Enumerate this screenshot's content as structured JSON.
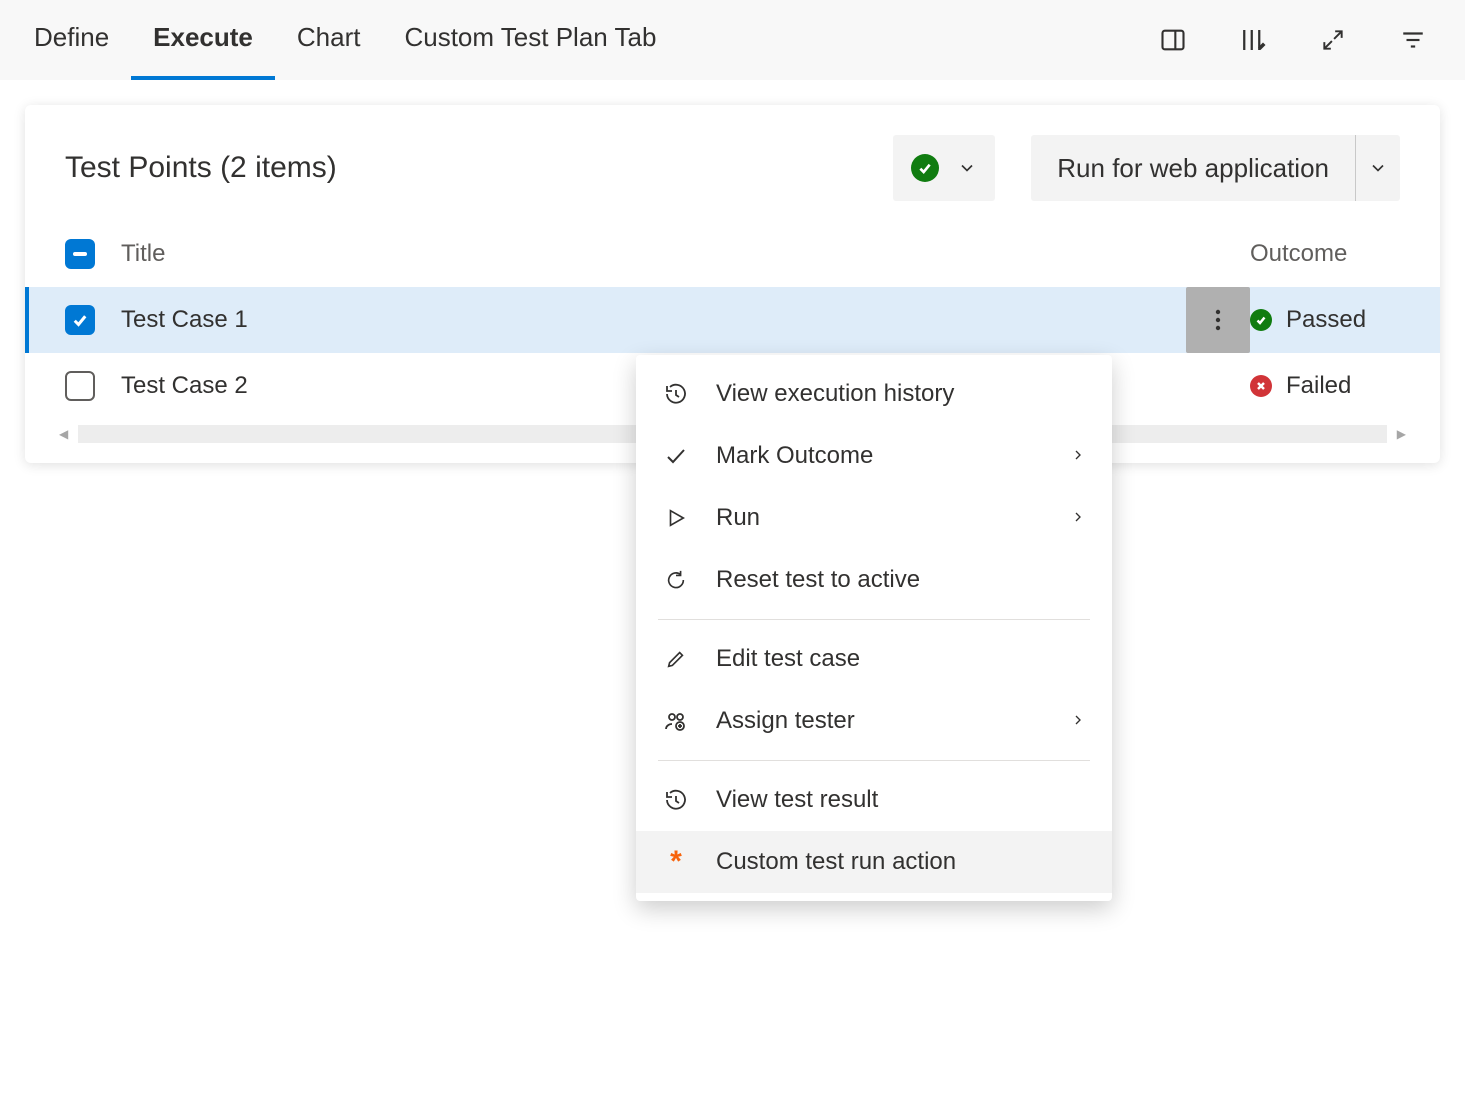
{
  "tabs": {
    "items": [
      {
        "label": "Define",
        "active": false
      },
      {
        "label": "Execute",
        "active": true
      },
      {
        "label": "Chart",
        "active": false
      },
      {
        "label": "Custom Test Plan Tab",
        "active": false
      }
    ]
  },
  "panel": {
    "title": "Test Points (2 items)",
    "runLabel": "Run for web application"
  },
  "columns": {
    "title": "Title",
    "outcome": "Outcome"
  },
  "rows": [
    {
      "title": "Test Case 1",
      "outcome": "Passed",
      "outcomeType": "pass",
      "checked": true,
      "selected": true
    },
    {
      "title": "Test Case 2",
      "outcome": "Failed",
      "outcomeType": "fail",
      "checked": false,
      "selected": false
    }
  ],
  "contextMenu": {
    "items": [
      {
        "icon": "history",
        "label": "View execution history",
        "submenu": false,
        "highlight": false
      },
      {
        "icon": "check",
        "label": "Mark Outcome",
        "submenu": true,
        "highlight": false
      },
      {
        "icon": "play",
        "label": "Run",
        "submenu": true,
        "highlight": false
      },
      {
        "icon": "refresh",
        "label": "Reset test to active",
        "submenu": false,
        "highlight": false
      },
      {
        "divider": true
      },
      {
        "icon": "pencil",
        "label": "Edit test case",
        "submenu": false,
        "highlight": false
      },
      {
        "icon": "people",
        "label": "Assign tester",
        "submenu": true,
        "highlight": false
      },
      {
        "divider": true
      },
      {
        "icon": "history",
        "label": "View test result",
        "submenu": false,
        "highlight": false
      },
      {
        "icon": "star",
        "label": "Custom test run action",
        "submenu": false,
        "highlight": true
      }
    ]
  }
}
